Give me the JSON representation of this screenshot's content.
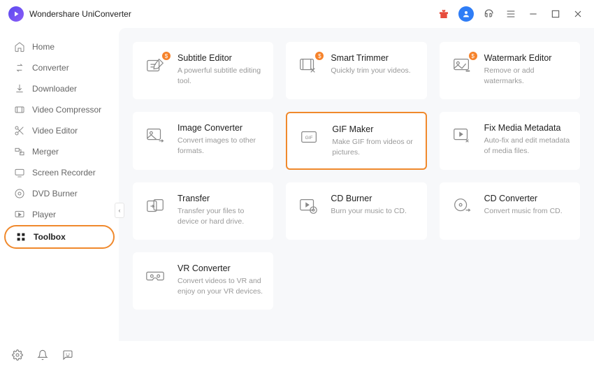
{
  "app_title": "Wondershare UniConverter",
  "sidebar": {
    "items": [
      {
        "label": "Home"
      },
      {
        "label": "Converter"
      },
      {
        "label": "Downloader"
      },
      {
        "label": "Video Compressor"
      },
      {
        "label": "Video Editor"
      },
      {
        "label": "Merger"
      },
      {
        "label": "Screen Recorder"
      },
      {
        "label": "DVD Burner"
      },
      {
        "label": "Player"
      },
      {
        "label": "Toolbox"
      }
    ]
  },
  "cards": [
    {
      "title": "Subtitle Editor",
      "desc": "A powerful subtitle editing tool.",
      "badge": "$"
    },
    {
      "title": "Smart Trimmer",
      "desc": "Quickly trim your videos.",
      "badge": "$"
    },
    {
      "title": "Watermark Editor",
      "desc": "Remove or add watermarks.",
      "badge": "$"
    },
    {
      "title": "Image Converter",
      "desc": "Convert images to other formats."
    },
    {
      "title": "GIF Maker",
      "desc": "Make GIF from videos or pictures."
    },
    {
      "title": "Fix Media Metadata",
      "desc": "Auto-fix and edit metadata of media files."
    },
    {
      "title": "Transfer",
      "desc": "Transfer your files to device or hard drive."
    },
    {
      "title": "CD Burner",
      "desc": "Burn your music to CD."
    },
    {
      "title": "CD Converter",
      "desc": "Convert music from CD."
    },
    {
      "title": "VR Converter",
      "desc": "Convert videos to VR and enjoy on your VR devices."
    }
  ]
}
